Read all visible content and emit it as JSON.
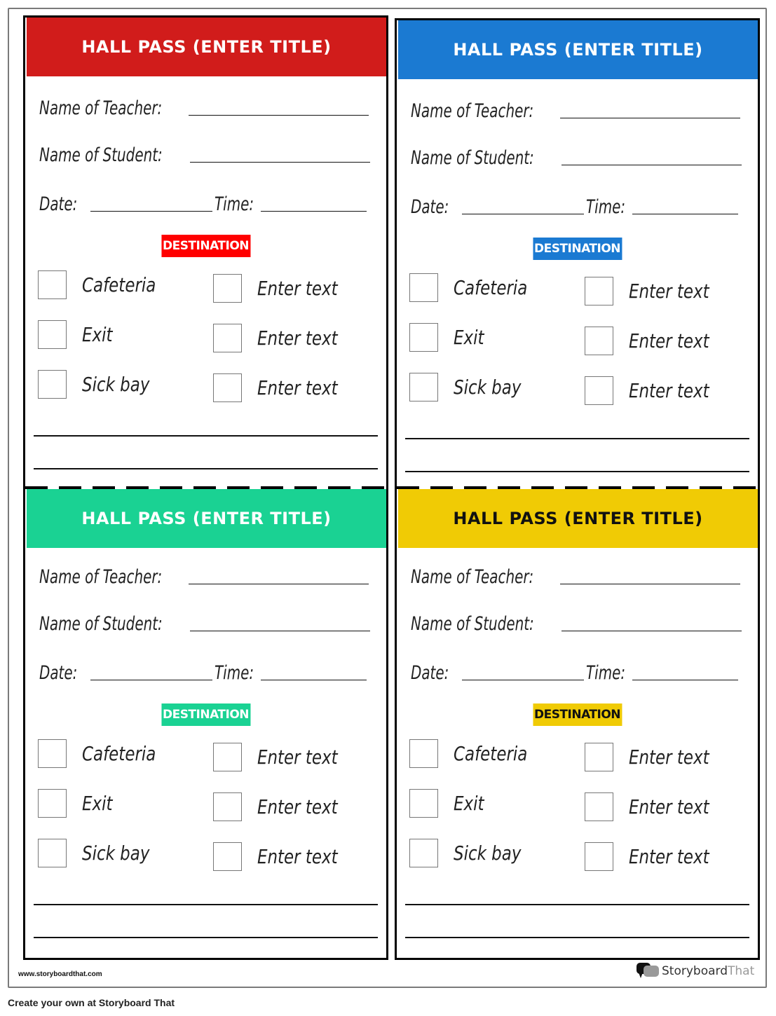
{
  "passes": [
    {
      "id": "red",
      "title": "HALL PASS (ENTER TITLE)",
      "header_color": "#D11C1B",
      "title_color": "#ffffff",
      "badge_color": "#FF0000",
      "badge_text_color": "#ffffff",
      "teacher_label": "Name of Teacher:",
      "student_label": "Name of Student:",
      "date_label": "Date:",
      "time_label": "Time:",
      "destination_label": "DESTINATION",
      "options_left": [
        "Cafeteria",
        "Exit",
        "Sick bay"
      ],
      "options_right": [
        "Enter text",
        "Enter text",
        "Enter text"
      ]
    },
    {
      "id": "blue",
      "title": "HALL PASS (ENTER TITLE)",
      "header_color": "#1B7AD2",
      "title_color": "#ffffff",
      "badge_color": "#1B7AD2",
      "badge_text_color": "#ffffff",
      "teacher_label": "Name of Teacher:",
      "student_label": "Name of Student:",
      "date_label": "Date:",
      "time_label": "Time:",
      "destination_label": "DESTINATION",
      "options_left": [
        "Cafeteria",
        "Exit",
        "Sick bay"
      ],
      "options_right": [
        "Enter text",
        "Enter text",
        "Enter text"
      ]
    },
    {
      "id": "green",
      "title": "HALL PASS (ENTER TITLE)",
      "header_color": "#1AD293",
      "title_color": "#ffffff",
      "badge_color": "#1AD293",
      "badge_text_color": "#ffffff",
      "teacher_label": "Name of Teacher:",
      "student_label": "Name of Student:",
      "date_label": "Date:",
      "time_label": "Time:",
      "destination_label": "DESTINATION",
      "options_left": [
        "Cafeteria",
        "Exit",
        "Sick bay"
      ],
      "options_right": [
        "Enter text",
        "Enter text",
        "Enter text"
      ]
    },
    {
      "id": "yellow",
      "title": "HALL PASS (ENTER TITLE)",
      "header_color": "#F0CB05",
      "title_color": "#111111",
      "badge_color": "#F0CB05",
      "badge_text_color": "#111111",
      "teacher_label": "Name of Teacher:",
      "student_label": "Name of Student:",
      "date_label": "Date:",
      "time_label": "Time:",
      "destination_label": "DESTINATION",
      "options_left": [
        "Cafeteria",
        "Exit",
        "Sick bay"
      ],
      "options_right": [
        "Enter text",
        "Enter text",
        "Enter text"
      ]
    }
  ],
  "footer": {
    "url": "www.storyboardthat.com",
    "brand_dark": "Storyboard",
    "brand_light": "That",
    "brand_icon": "speech-bubbles-icon",
    "create_own": "Create your own at Storyboard That"
  }
}
